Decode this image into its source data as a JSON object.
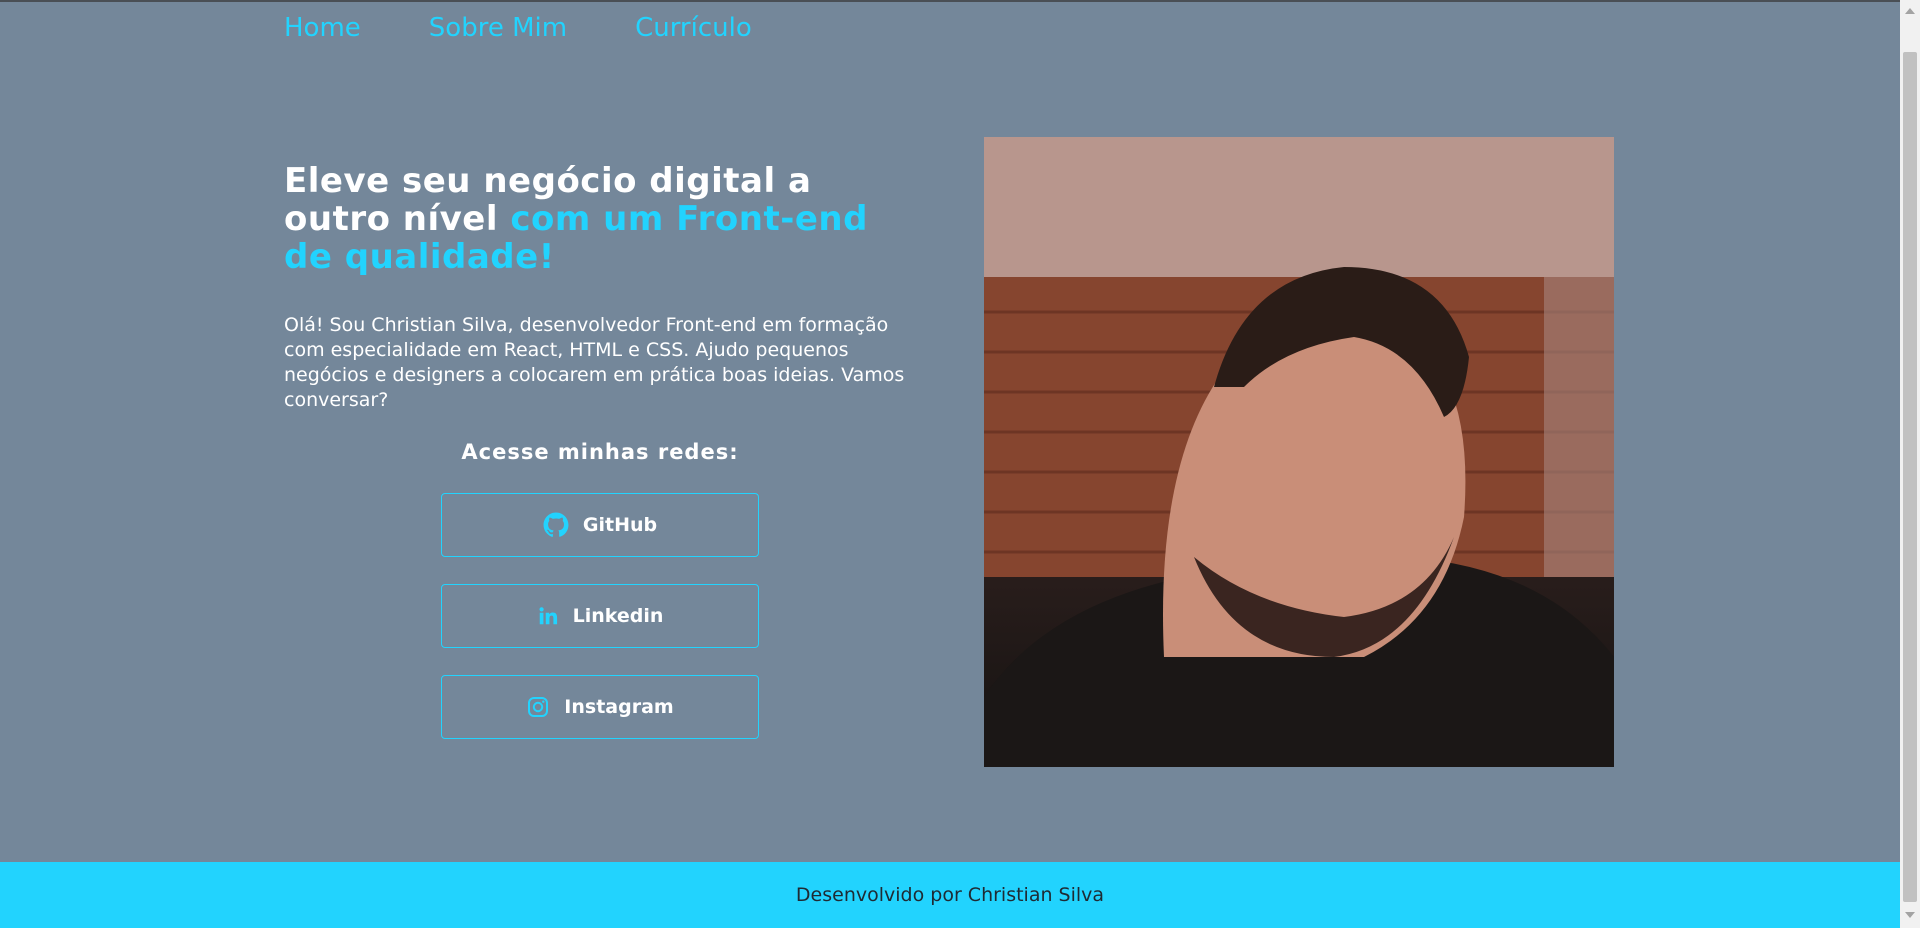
{
  "nav": {
    "items": [
      {
        "label": "Home"
      },
      {
        "label": "Sobre Mim"
      },
      {
        "label": "Currículo"
      }
    ]
  },
  "hero": {
    "title_white": "Eleve seu negócio digital a outro nível",
    "title_accent": "com um Front-end de qualidade!",
    "intro": "Olá! Sou Christian Silva, desenvolvedor Front-end em formação com especialidade em React, HTML e CSS. Ajudo pequenos negócios e designers a colocarem em prática boas ideias. Vamos conversar?"
  },
  "social": {
    "title": "Acesse minhas redes:",
    "links": [
      {
        "label": "GitHub",
        "icon": "github-icon"
      },
      {
        "label": "Linkedin",
        "icon": "linkedin-icon"
      },
      {
        "label": "Instagram",
        "icon": "instagram-icon"
      }
    ]
  },
  "footer": {
    "text": "Desenvolvido por Christian Silva"
  },
  "colors": {
    "background": "#74879a",
    "accent": "#22d3fe",
    "text": "#ffffff"
  }
}
